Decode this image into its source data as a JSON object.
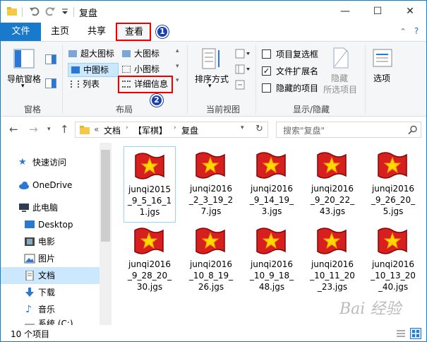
{
  "window": {
    "title": "复盘",
    "minimize": "—",
    "maximize": "☐",
    "close": "✕"
  },
  "ribbon_tabs": {
    "file": "文件",
    "home": "主页",
    "share": "共享",
    "view": "查看",
    "help_icon": "?",
    "collapse_icon": "⌃"
  },
  "annotations": {
    "marker_1": "1",
    "marker_2": "2"
  },
  "ribbon": {
    "panes": {
      "nav_pane": "导航窗格",
      "group": "窗格"
    },
    "layout": {
      "extra_large": "超大图标",
      "large": "大图标",
      "medium": "中图标",
      "small": "小图标",
      "list": "列表",
      "details": "详细信息",
      "group": "布局",
      "selected": "中图标"
    },
    "current_view": {
      "sort_by": "排序方式",
      "group": "当前视图"
    },
    "show_hide": {
      "item_checkboxes": "项目复选框",
      "item_checkboxes_checked": false,
      "file_extensions": "文件扩展名",
      "file_extensions_checked": true,
      "hidden_items": "隐藏的项目",
      "hidden_items_checked": false,
      "hide": "隐藏",
      "selected_items": "所选项目",
      "group": "显示/隐藏"
    },
    "options": {
      "label": "选项"
    }
  },
  "address": {
    "prefix": "«",
    "crumbs": [
      "文档",
      "【军棋】",
      "复盘"
    ],
    "search_placeholder": "搜索\"复盘\""
  },
  "nav": {
    "items": [
      {
        "label": "快速访问",
        "icon": "star-icon"
      },
      {
        "label": "OneDrive",
        "icon": "cloud-icon"
      },
      {
        "label": "此电脑",
        "icon": "computer-icon"
      },
      {
        "label": "Desktop",
        "icon": "desktop-icon"
      },
      {
        "label": "电影",
        "icon": "film-icon"
      },
      {
        "label": "图片",
        "icon": "picture-icon"
      },
      {
        "label": "文档",
        "icon": "document-icon"
      },
      {
        "label": "下载",
        "icon": "download-icon"
      },
      {
        "label": "音乐",
        "icon": "music-icon"
      },
      {
        "label": "系统 (C:)",
        "icon": "drive-icon"
      }
    ],
    "selected": "文档"
  },
  "files": [
    "junqi2015_9_5_16_11.jgs",
    "junqi2016_2_3_19_27.jgs",
    "junqi2016_9_14_19_3.jgs",
    "junqi2016_9_20_22_43.jgs",
    "junqi2016_9_26_20_5.jgs",
    "junqi2016_9_28_20_30.jgs",
    "junqi2016_10_8_19_26.jgs",
    "junqi2016_10_9_18_48.jgs",
    "junqi2016_10_11_20_23.jgs",
    "junqi2016_10_13_20_40.jgs"
  ],
  "status": {
    "count": "10 个项目"
  },
  "watermark": "Bai 经验"
}
